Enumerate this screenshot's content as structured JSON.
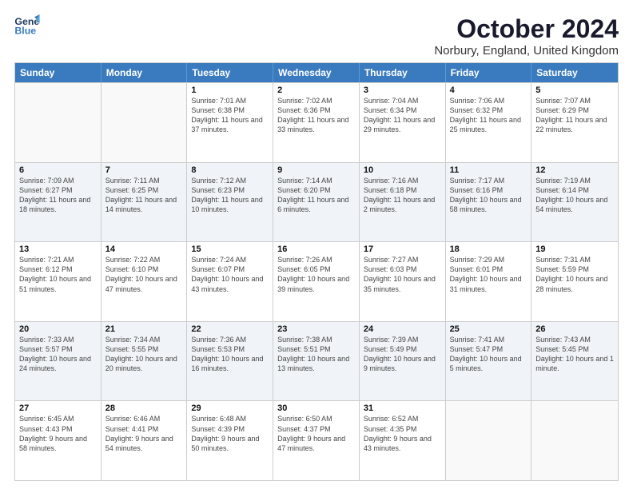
{
  "header": {
    "logo_line1": "General",
    "logo_line2": "Blue",
    "month": "October 2024",
    "location": "Norbury, England, United Kingdom"
  },
  "weekdays": [
    "Sunday",
    "Monday",
    "Tuesday",
    "Wednesday",
    "Thursday",
    "Friday",
    "Saturday"
  ],
  "rows": [
    [
      {
        "day": "",
        "sunrise": "",
        "sunset": "",
        "daylight": ""
      },
      {
        "day": "",
        "sunrise": "",
        "sunset": "",
        "daylight": ""
      },
      {
        "day": "1",
        "sunrise": "Sunrise: 7:01 AM",
        "sunset": "Sunset: 6:38 PM",
        "daylight": "Daylight: 11 hours and 37 minutes."
      },
      {
        "day": "2",
        "sunrise": "Sunrise: 7:02 AM",
        "sunset": "Sunset: 6:36 PM",
        "daylight": "Daylight: 11 hours and 33 minutes."
      },
      {
        "day": "3",
        "sunrise": "Sunrise: 7:04 AM",
        "sunset": "Sunset: 6:34 PM",
        "daylight": "Daylight: 11 hours and 29 minutes."
      },
      {
        "day": "4",
        "sunrise": "Sunrise: 7:06 AM",
        "sunset": "Sunset: 6:32 PM",
        "daylight": "Daylight: 11 hours and 25 minutes."
      },
      {
        "day": "5",
        "sunrise": "Sunrise: 7:07 AM",
        "sunset": "Sunset: 6:29 PM",
        "daylight": "Daylight: 11 hours and 22 minutes."
      }
    ],
    [
      {
        "day": "6",
        "sunrise": "Sunrise: 7:09 AM",
        "sunset": "Sunset: 6:27 PM",
        "daylight": "Daylight: 11 hours and 18 minutes."
      },
      {
        "day": "7",
        "sunrise": "Sunrise: 7:11 AM",
        "sunset": "Sunset: 6:25 PM",
        "daylight": "Daylight: 11 hours and 14 minutes."
      },
      {
        "day": "8",
        "sunrise": "Sunrise: 7:12 AM",
        "sunset": "Sunset: 6:23 PM",
        "daylight": "Daylight: 11 hours and 10 minutes."
      },
      {
        "day": "9",
        "sunrise": "Sunrise: 7:14 AM",
        "sunset": "Sunset: 6:20 PM",
        "daylight": "Daylight: 11 hours and 6 minutes."
      },
      {
        "day": "10",
        "sunrise": "Sunrise: 7:16 AM",
        "sunset": "Sunset: 6:18 PM",
        "daylight": "Daylight: 11 hours and 2 minutes."
      },
      {
        "day": "11",
        "sunrise": "Sunrise: 7:17 AM",
        "sunset": "Sunset: 6:16 PM",
        "daylight": "Daylight: 10 hours and 58 minutes."
      },
      {
        "day": "12",
        "sunrise": "Sunrise: 7:19 AM",
        "sunset": "Sunset: 6:14 PM",
        "daylight": "Daylight: 10 hours and 54 minutes."
      }
    ],
    [
      {
        "day": "13",
        "sunrise": "Sunrise: 7:21 AM",
        "sunset": "Sunset: 6:12 PM",
        "daylight": "Daylight: 10 hours and 51 minutes."
      },
      {
        "day": "14",
        "sunrise": "Sunrise: 7:22 AM",
        "sunset": "Sunset: 6:10 PM",
        "daylight": "Daylight: 10 hours and 47 minutes."
      },
      {
        "day": "15",
        "sunrise": "Sunrise: 7:24 AM",
        "sunset": "Sunset: 6:07 PM",
        "daylight": "Daylight: 10 hours and 43 minutes."
      },
      {
        "day": "16",
        "sunrise": "Sunrise: 7:26 AM",
        "sunset": "Sunset: 6:05 PM",
        "daylight": "Daylight: 10 hours and 39 minutes."
      },
      {
        "day": "17",
        "sunrise": "Sunrise: 7:27 AM",
        "sunset": "Sunset: 6:03 PM",
        "daylight": "Daylight: 10 hours and 35 minutes."
      },
      {
        "day": "18",
        "sunrise": "Sunrise: 7:29 AM",
        "sunset": "Sunset: 6:01 PM",
        "daylight": "Daylight: 10 hours and 31 minutes."
      },
      {
        "day": "19",
        "sunrise": "Sunrise: 7:31 AM",
        "sunset": "Sunset: 5:59 PM",
        "daylight": "Daylight: 10 hours and 28 minutes."
      }
    ],
    [
      {
        "day": "20",
        "sunrise": "Sunrise: 7:33 AM",
        "sunset": "Sunset: 5:57 PM",
        "daylight": "Daylight: 10 hours and 24 minutes."
      },
      {
        "day": "21",
        "sunrise": "Sunrise: 7:34 AM",
        "sunset": "Sunset: 5:55 PM",
        "daylight": "Daylight: 10 hours and 20 minutes."
      },
      {
        "day": "22",
        "sunrise": "Sunrise: 7:36 AM",
        "sunset": "Sunset: 5:53 PM",
        "daylight": "Daylight: 10 hours and 16 minutes."
      },
      {
        "day": "23",
        "sunrise": "Sunrise: 7:38 AM",
        "sunset": "Sunset: 5:51 PM",
        "daylight": "Daylight: 10 hours and 13 minutes."
      },
      {
        "day": "24",
        "sunrise": "Sunrise: 7:39 AM",
        "sunset": "Sunset: 5:49 PM",
        "daylight": "Daylight: 10 hours and 9 minutes."
      },
      {
        "day": "25",
        "sunrise": "Sunrise: 7:41 AM",
        "sunset": "Sunset: 5:47 PM",
        "daylight": "Daylight: 10 hours and 5 minutes."
      },
      {
        "day": "26",
        "sunrise": "Sunrise: 7:43 AM",
        "sunset": "Sunset: 5:45 PM",
        "daylight": "Daylight: 10 hours and 1 minute."
      }
    ],
    [
      {
        "day": "27",
        "sunrise": "Sunrise: 6:45 AM",
        "sunset": "Sunset: 4:43 PM",
        "daylight": "Daylight: 9 hours and 58 minutes."
      },
      {
        "day": "28",
        "sunrise": "Sunrise: 6:46 AM",
        "sunset": "Sunset: 4:41 PM",
        "daylight": "Daylight: 9 hours and 54 minutes."
      },
      {
        "day": "29",
        "sunrise": "Sunrise: 6:48 AM",
        "sunset": "Sunset: 4:39 PM",
        "daylight": "Daylight: 9 hours and 50 minutes."
      },
      {
        "day": "30",
        "sunrise": "Sunrise: 6:50 AM",
        "sunset": "Sunset: 4:37 PM",
        "daylight": "Daylight: 9 hours and 47 minutes."
      },
      {
        "day": "31",
        "sunrise": "Sunrise: 6:52 AM",
        "sunset": "Sunset: 4:35 PM",
        "daylight": "Daylight: 9 hours and 43 minutes."
      },
      {
        "day": "",
        "sunrise": "",
        "sunset": "",
        "daylight": ""
      },
      {
        "day": "",
        "sunrise": "",
        "sunset": "",
        "daylight": ""
      }
    ]
  ]
}
